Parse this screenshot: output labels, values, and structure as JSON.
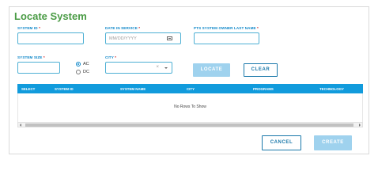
{
  "dialog": {
    "title": "Locate System"
  },
  "fields": {
    "system_id": {
      "label": "SYSTEM ID",
      "required": "*",
      "value": ""
    },
    "date_in_service": {
      "label": "DATE IN SERVICE",
      "required": "*",
      "placeholder": "MM/DD/YYYY",
      "icon": "calendar-icon"
    },
    "owner_last_name": {
      "label": "PTS SYSTEM OWNER LAST NAME",
      "required": "*",
      "value": ""
    },
    "system_size": {
      "label": "SYSTEM SIZE",
      "required": "*",
      "value": ""
    },
    "current_type": {
      "options": [
        "AC",
        "DC"
      ],
      "selected": "AC"
    },
    "city": {
      "label": "CITY",
      "required": "*",
      "clear_glyph": "×",
      "value": ""
    }
  },
  "buttons": {
    "locate": "LOCATE",
    "clear": "CLEAR",
    "cancel": "CANCEL",
    "create": "CREATE"
  },
  "grid": {
    "columns": [
      "SELECT",
      "SYSTEM ID",
      "SYSTEM NAME",
      "CITY",
      "PROGRAMS",
      "TECHNOLOGY"
    ],
    "empty_message": "No Rows To Show"
  },
  "colors": {
    "title": "#4a9b45",
    "label": "#0c86c8",
    "grid_header": "#119bdc",
    "disabled_button": "#9fd2ee"
  }
}
